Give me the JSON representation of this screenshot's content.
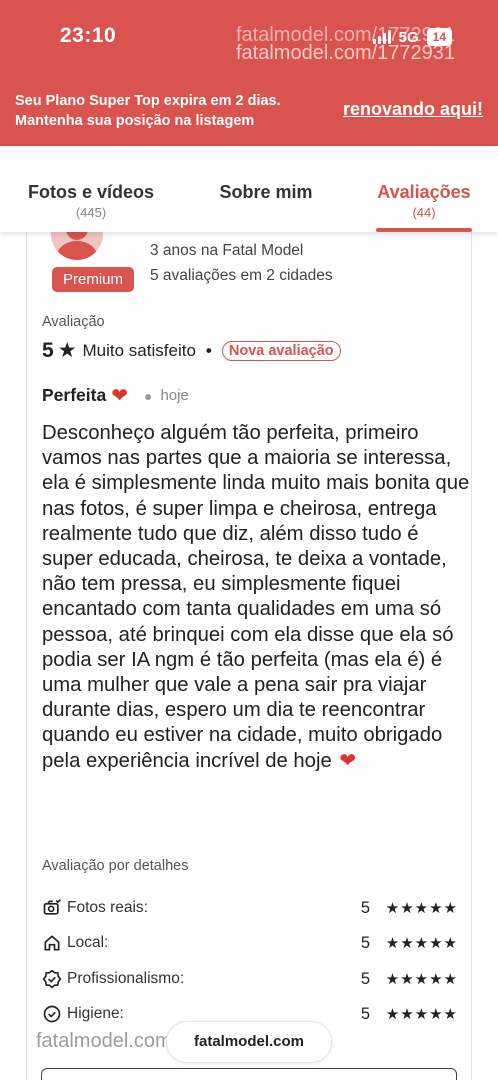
{
  "status_bar": {
    "time": "23:10",
    "network": "5G",
    "battery": "14"
  },
  "watermark": {
    "line1": "fatalmodel.com/1772931",
    "line2": "fatalmodel.com/1772931",
    "bottom": "fatalmodel.com/1772931"
  },
  "plan_banner": {
    "line1": "Seu Plano Super Top expira em 2 dias.",
    "line2": "Mantenha sua posição na listagem",
    "link": "renovando aqui!"
  },
  "tabs": [
    {
      "label": "Fotos e vídeos",
      "count": "(445)"
    },
    {
      "label": "Sobre mim",
      "count": ""
    },
    {
      "label": "Avaliações",
      "count": "(44)"
    }
  ],
  "reviewer": {
    "badge": "Premium",
    "since": "3 anos na Fatal Model",
    "reviews": "5 avaliações em 2 cidades"
  },
  "review": {
    "section_label": "Avaliação",
    "score": "5",
    "score_text": "Muito satisfeito",
    "tag": "Nova avaliação",
    "title": "Perfeita",
    "time": "hoje",
    "body": "Desconheço alguém tão perfeita, primeiro vamos nas partes que a maioria se interessa, ela é simplesmente linda muito mais bonita que nas fotos, é super limpa e cheirosa, entrega realmente tudo que diz, além disso tudo é super educada, cheirosa, te deixa a vontade, não tem pressa, eu simplesmente fiquei encantado com tanta qualidades em uma só pessoa, até brinquei com ela disse que ela só podia ser IA ngm é tão perfeita (mas ela é) é uma mulher que vale a pena sair pra viajar durante dias, espero um dia te reencontrar quando eu estiver na cidade, muito obrigado pela experiência incrível de hoje"
  },
  "details": {
    "label": "Avaliação por detalhes",
    "items": [
      {
        "label": "Fotos reais:",
        "value": "5",
        "stars": "★★★★★",
        "icon": "camera-check-icon"
      },
      {
        "label": "Local:",
        "value": "5",
        "stars": "★★★★★",
        "icon": "home-icon"
      },
      {
        "label": "Profissionalismo:",
        "value": "5",
        "stars": "★★★★★",
        "icon": "shield-check-icon"
      },
      {
        "label": "Higiene:",
        "value": "5",
        "stars": "★★★★★",
        "icon": "check-circle-icon"
      }
    ]
  },
  "url_pill": "fatalmodel.com",
  "colors": {
    "brand": "#d9534f",
    "text": "#222222",
    "muted": "#888888"
  }
}
